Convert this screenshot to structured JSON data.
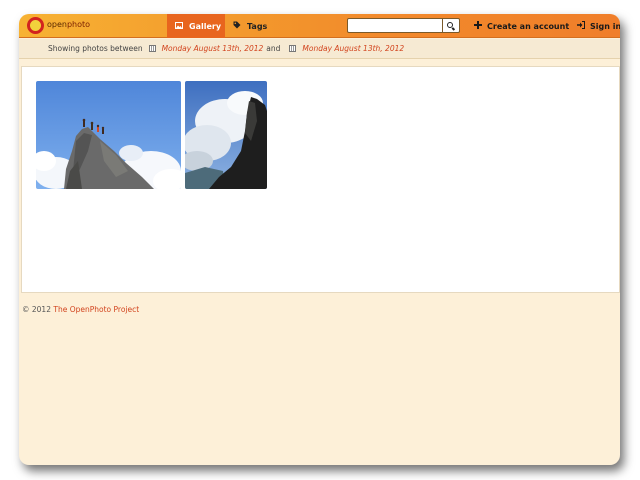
{
  "header": {
    "logo": {
      "part1": "open",
      "part2": "photo"
    },
    "tabs": [
      {
        "label": "Gallery",
        "icon": "image-icon",
        "active": true
      },
      {
        "label": "Tags",
        "icon": "tag-icon",
        "active": false
      }
    ],
    "search": {
      "value": "",
      "placeholder": ""
    },
    "create_account_label": "Create an account",
    "sign_in_label": "Sign in"
  },
  "filter": {
    "prefix": "Showing photos between",
    "start_date": "Monday August 13th, 2012",
    "connector": "and",
    "end_date": "Monday August 13th, 2012"
  },
  "photos": [
    {
      "name": "climbers-on-rock-summit"
    },
    {
      "name": "rock-pinnacle-and-clouds"
    }
  ],
  "footer": {
    "copyright": "© 2012",
    "link_text": "The OpenPhoto Project"
  },
  "colors": {
    "accent": "#e8651e",
    "link": "#d2441e",
    "background": "#fdf0d8"
  }
}
